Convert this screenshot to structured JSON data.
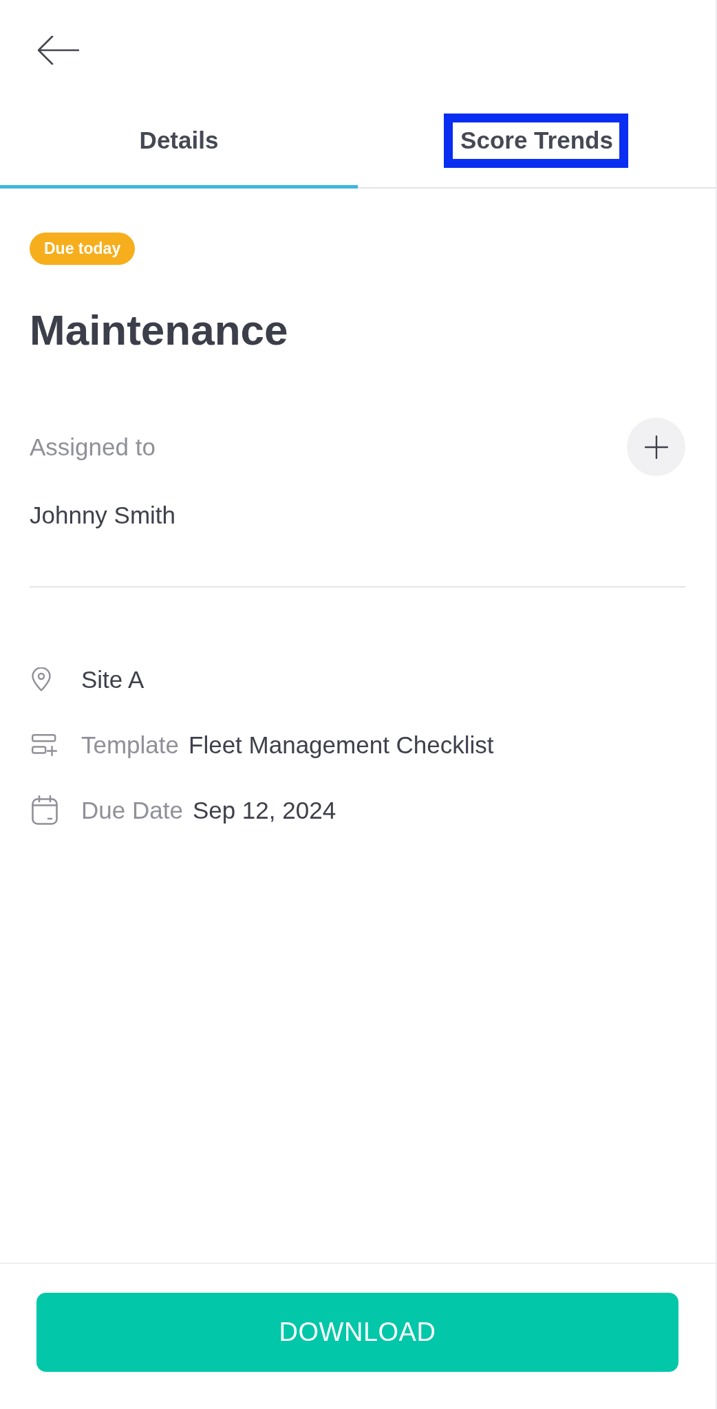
{
  "tabs": [
    {
      "label": "Details",
      "selected": true,
      "highlighted": false
    },
    {
      "label": "Score Trends",
      "selected": false,
      "highlighted": true
    }
  ],
  "status_badge": {
    "label": "Due today"
  },
  "title": "Maintenance",
  "assignment": {
    "label": "Assigned to",
    "assignee": "Johnny Smith"
  },
  "info_rows": [
    {
      "kind": "location",
      "value": "Site A"
    },
    {
      "kind": "template",
      "label": "Template",
      "value": "Fleet Management Checklist"
    },
    {
      "kind": "due_date",
      "label": "Due Date",
      "value": "Sep 12, 2024"
    }
  ],
  "footer": {
    "button": "DOWNLOAD"
  }
}
